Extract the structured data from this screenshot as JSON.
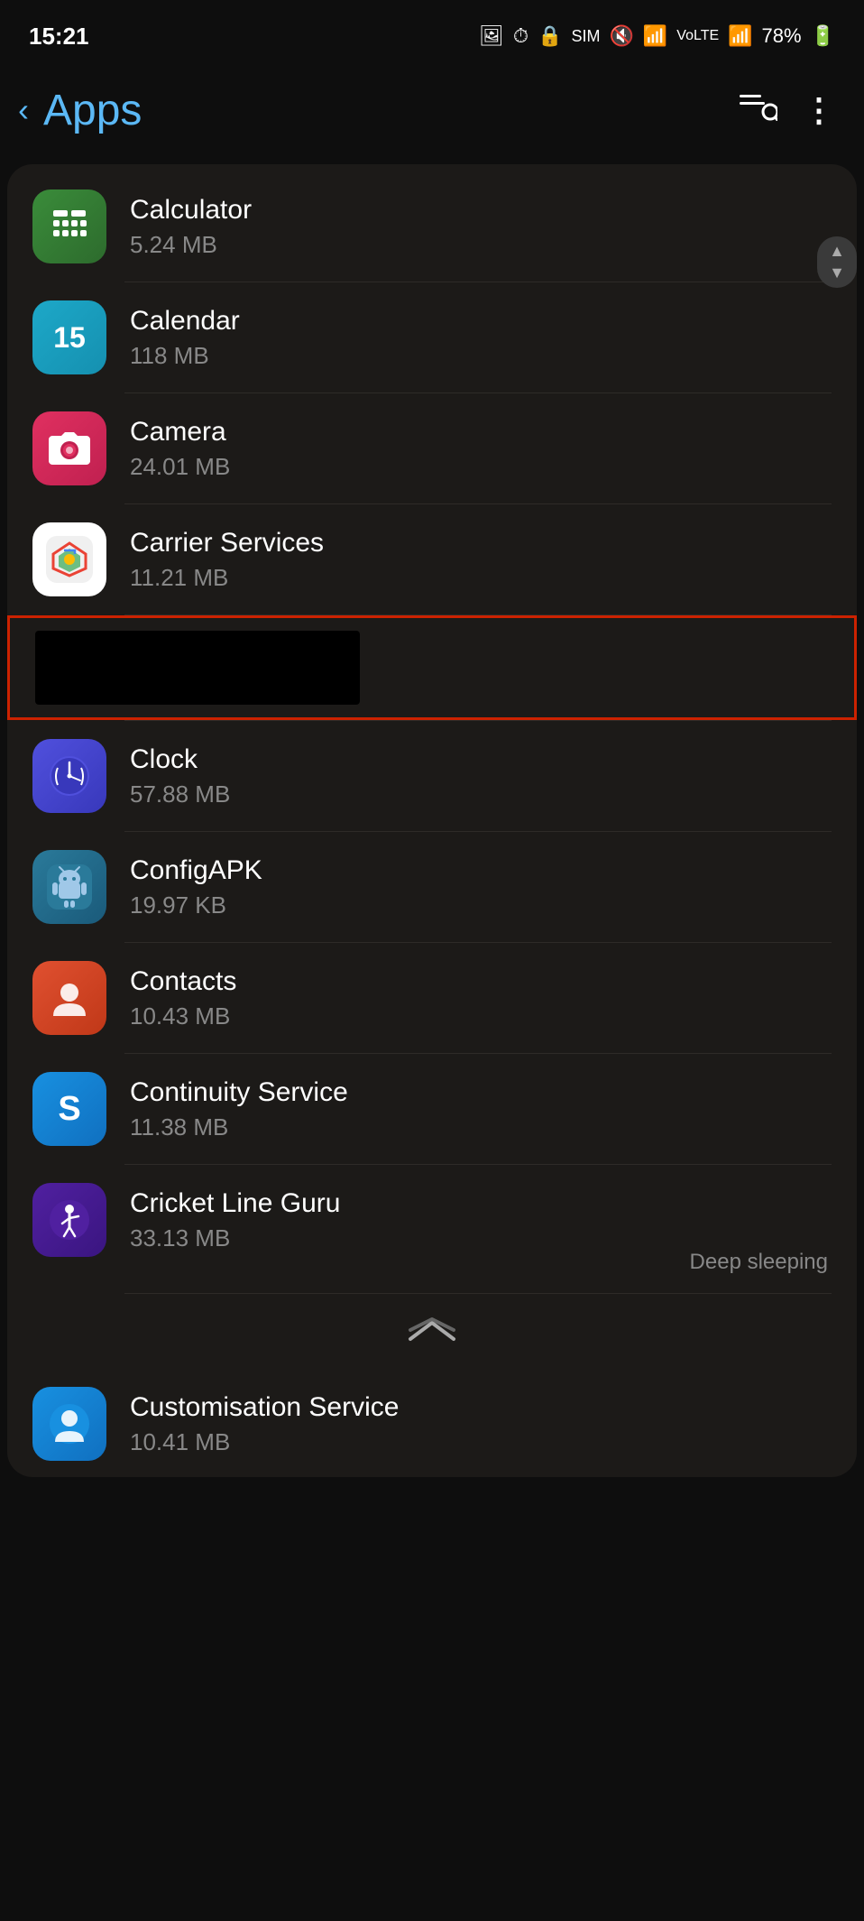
{
  "statusBar": {
    "time": "15:21",
    "battery": "78%",
    "icons": [
      "📷",
      "🔇",
      "WiFi",
      "VoLTE",
      "Signal"
    ]
  },
  "header": {
    "title": "Apps",
    "backLabel": "‹",
    "searchIcon": "🔍",
    "moreIcon": "⋮"
  },
  "apps": [
    {
      "id": "calculator",
      "name": "Calculator",
      "size": "5.24 MB",
      "iconClass": "icon-calculator",
      "iconText": "+-\n×÷",
      "deepSleeping": false
    },
    {
      "id": "calendar",
      "name": "Calendar",
      "size": "118 MB",
      "iconClass": "icon-calendar",
      "iconText": "15",
      "deepSleeping": false
    },
    {
      "id": "camera",
      "name": "Camera",
      "size": "24.01 MB",
      "iconClass": "icon-camera",
      "iconText": "📷",
      "deepSleeping": false
    },
    {
      "id": "carrier-services",
      "name": "Carrier Services",
      "size": "11.21 MB",
      "iconClass": "icon-carrier",
      "iconText": "★",
      "deepSleeping": false
    },
    {
      "id": "redacted",
      "name": "",
      "size": "",
      "redacted": true,
      "deepSleeping": false
    },
    {
      "id": "clock",
      "name": "Clock",
      "size": "57.88 MB",
      "iconClass": "icon-clock",
      "iconText": "⏱",
      "deepSleeping": false
    },
    {
      "id": "configapk",
      "name": "ConfigAPK",
      "size": "19.97 KB",
      "iconClass": "icon-configapk",
      "iconText": "🤖",
      "deepSleeping": false
    },
    {
      "id": "contacts",
      "name": "Contacts",
      "size": "10.43 MB",
      "iconClass": "icon-contacts",
      "iconText": "👤",
      "deepSleeping": false
    },
    {
      "id": "continuity",
      "name": "Continuity Service",
      "size": "11.38 MB",
      "iconClass": "icon-continuity",
      "iconText": "S",
      "deepSleeping": false
    },
    {
      "id": "cricket",
      "name": "Cricket Line Guru",
      "size": "33.13 MB",
      "iconClass": "icon-cricket",
      "iconText": "🏏",
      "deepSleeping": true
    },
    {
      "id": "customisation",
      "name": "Customisation Service",
      "size": "10.41 MB",
      "iconClass": "icon-customisation",
      "iconText": "👤",
      "deepSleeping": false
    }
  ],
  "labels": {
    "deepSleeping": "Deep sleeping",
    "navUp": "⌃"
  }
}
